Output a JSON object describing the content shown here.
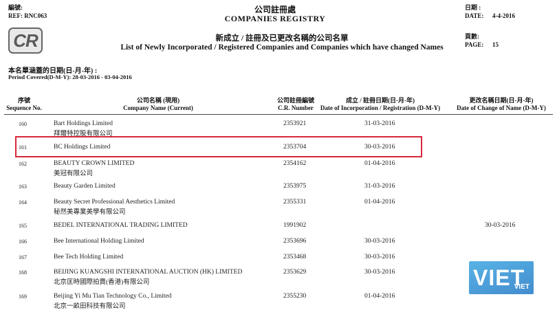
{
  "header": {
    "file_label_cn": "編號:",
    "ref": "REF: RNC063",
    "title_cn": "公司註冊處",
    "title_en": "COMPANIES REGISTRY",
    "date_label_cn": "日期 :",
    "date_label": "DATE:",
    "date_value": "4-4-2016",
    "subtitle_cn": "新成立 / 註冊及已更改名稱的公司名單",
    "subtitle_en": "List of Newly Incorporated / Registered Companies and Companies which have changed Names",
    "page_label_cn": "頁數:",
    "page_label": "PAGE:",
    "page_value": "15",
    "logo_text": "CR",
    "period_cn": "本名單涵蓋的日期(日-月-年) :",
    "period_en": "Period Covered(D-M-Y): 28-03-2016 - 03-04-2016"
  },
  "columns": {
    "seq_cn": "序號",
    "seq_en": "Sequence No.",
    "name_cn": "公司名稱 (現用)",
    "name_en": "Company Name (Current)",
    "cr_cn": "公司註冊編號",
    "cr_en": "C.R. Number",
    "inc_cn": "成立 / 註冊日期(日-月-年)",
    "inc_en": "Date of Incorporation / Registration (D-M-Y)",
    "chg_cn": "更改名稱日期(日-月-年)",
    "chg_en": "Date of Change of Name (D-M-Y)"
  },
  "rows": [
    {
      "seq": "160",
      "name": "Bart Holdings Limited",
      "name_cn": "拜爾特控股有限公司",
      "cr": "2353921",
      "inc": "31-03-2016",
      "chg": ""
    },
    {
      "seq": "161",
      "name": "BC Holdings Limited",
      "name_cn": "",
      "cr": "2353704",
      "inc": "30-03-2016",
      "chg": ""
    },
    {
      "seq": "162",
      "name": "BEAUTY CROWN LIMITED",
      "name_cn": "美冠有限公司",
      "cr": "2354162",
      "inc": "01-04-2016",
      "chg": ""
    },
    {
      "seq": "163",
      "name": "Beauty Garden Limited",
      "name_cn": "",
      "cr": "2353975",
      "inc": "31-03-2016",
      "chg": ""
    },
    {
      "seq": "164",
      "name": "Beauty Secret Professional Aesthetics Limited",
      "name_cn": "秘然美專業美學有限公司",
      "cr": "2355331",
      "inc": "01-04-2016",
      "chg": ""
    },
    {
      "seq": "165",
      "name": "BEDEL INTERNATIONAL TRADING LIMITED",
      "name_cn": "",
      "cr": "1991902",
      "inc": "",
      "chg": "30-03-2016"
    },
    {
      "seq": "166",
      "name": "Bee International Holding Limited",
      "name_cn": "",
      "cr": "2353696",
      "inc": "30-03-2016",
      "chg": ""
    },
    {
      "seq": "167",
      "name": "Bee Tech Holding Limited",
      "name_cn": "",
      "cr": "2353468",
      "inc": "30-03-2016",
      "chg": ""
    },
    {
      "seq": "168",
      "name": "BEIJING KUANGSHI INTERNATIONAL AUCTION (HK) LIMITED",
      "name_cn": "北京匡時國際拍賣(香港)有限公司",
      "cr": "2353629",
      "inc": "30-03-2016",
      "chg": ""
    },
    {
      "seq": "169",
      "name": "Beijing Yi Mu Tian Technology Co., Limited",
      "name_cn": "北京一畝田科技有限公司",
      "cr": "2355230",
      "inc": "01-04-2016",
      "chg": ""
    }
  ],
  "watermark": {
    "text": "VIET",
    "sub": "VIET"
  },
  "colors": {
    "highlight": "#d6283a",
    "watermark": "#1f86d2"
  }
}
